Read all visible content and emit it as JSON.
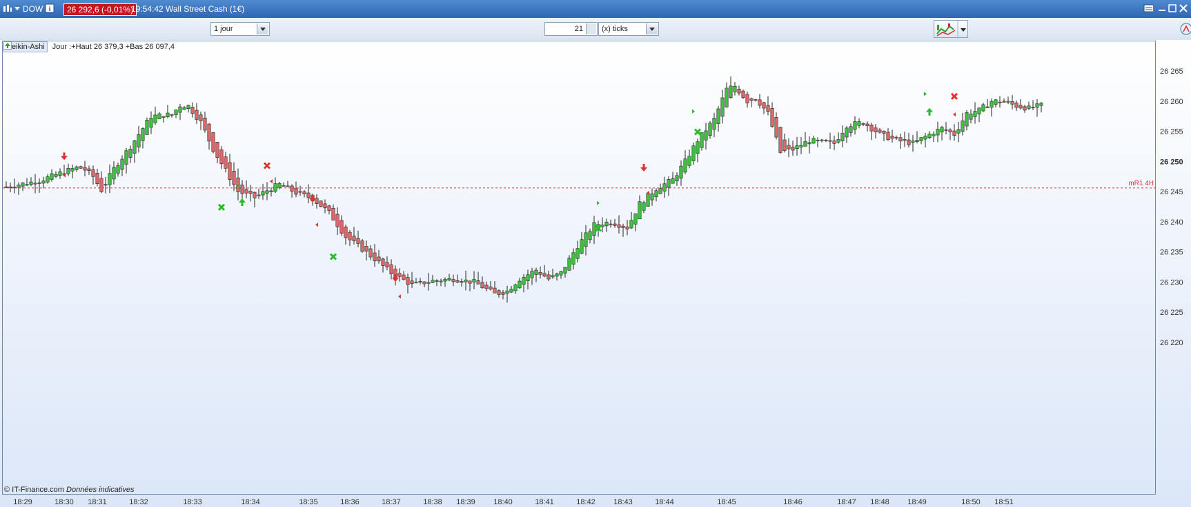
{
  "window": {
    "symbol": "DOW",
    "price_badge": "26 292,6 (-0,01%)",
    "time": "19:54:42",
    "instrument": "Wall Street Cash (1€)"
  },
  "toolbar": {
    "period_select": "1 jour",
    "tick_value": "21",
    "tick_unit_select": "(x) ticks"
  },
  "legend": {
    "chart_type": "Heikin-Ashi",
    "info": "Jour :+Haut 26 379,3 +Bas 26 097,4"
  },
  "footer": {
    "copyright": "© IT-Finance.com",
    "note": "Données indicatives"
  },
  "colors": {
    "up": "#3fc43f",
    "down": "#e06a6a",
    "level": "#e03030",
    "axis": "#333333"
  },
  "chart_data": {
    "type": "candlestick",
    "style": "Heikin-Ashi",
    "ylim": [
      26216,
      26267
    ],
    "y_ticks": [
      26220,
      26225,
      26230,
      26235,
      26240,
      26245,
      26250,
      26255,
      26260,
      26265
    ],
    "y_tick_labels": [
      "26 220",
      "26 225",
      "26 230",
      "26 235",
      "26 240",
      "26 245",
      "26 250",
      "26 255",
      "26 260",
      "26 265"
    ],
    "x_tick_labels": [
      "18:29",
      "18:30",
      "18:31",
      "18:32",
      "18:33",
      "18:34",
      "18:35",
      "18:36",
      "18:37",
      "18:38",
      "18:39",
      "18:40",
      "18:41",
      "18:42",
      "18:43",
      "18:44",
      "18:45",
      "18:46",
      "18:47",
      "18:48",
      "18:49",
      "18:50",
      "18:51"
    ],
    "x_tick_index": [
      4,
      14,
      22,
      32,
      45,
      59,
      73,
      83,
      93,
      103,
      111,
      120,
      130,
      140,
      149,
      159,
      174,
      190,
      203,
      211,
      220,
      233,
      241
    ],
    "level_line": {
      "label": "mR1 4H",
      "value": 26245.6
    },
    "anchors": [
      [
        0,
        26245.8
      ],
      [
        8,
        26246.8
      ],
      [
        14,
        26248.3
      ],
      [
        18,
        26249.2
      ],
      [
        21,
        26247.5
      ],
      [
        23,
        26245.2
      ],
      [
        26,
        26248.8
      ],
      [
        30,
        26252.5
      ],
      [
        35,
        26257.5
      ],
      [
        40,
        26257.8
      ],
      [
        42,
        26259.3
      ],
      [
        44,
        26259.2
      ],
      [
        47,
        26256.5
      ],
      [
        50,
        26252.0
      ],
      [
        53,
        26248.5
      ],
      [
        56,
        26245.0
      ],
      [
        60,
        26244.0
      ],
      [
        63,
        26245.2
      ],
      [
        66,
        26246.2
      ],
      [
        70,
        26244.8
      ],
      [
        74,
        26243.8
      ],
      [
        78,
        26241.5
      ],
      [
        82,
        26237.5
      ],
      [
        85,
        26236.0
      ],
      [
        89,
        26233.8
      ],
      [
        93,
        26231.5
      ],
      [
        98,
        26229.5
      ],
      [
        103,
        26230.2
      ],
      [
        108,
        26230.5
      ],
      [
        113,
        26230.0
      ],
      [
        118,
        26228.0
      ],
      [
        121,
        26228.5
      ],
      [
        124,
        26230.5
      ],
      [
        128,
        26232.0
      ],
      [
        131,
        26230.5
      ],
      [
        134,
        26231.5
      ],
      [
        138,
        26236.0
      ],
      [
        142,
        26239.5
      ],
      [
        146,
        26240.0
      ],
      [
        150,
        26239.0
      ],
      [
        153,
        26243.0
      ],
      [
        157,
        26245.5
      ],
      [
        161,
        26247.0
      ],
      [
        164,
        26250.0
      ],
      [
        167,
        26253.5
      ],
      [
        171,
        26257.0
      ],
      [
        174,
        26262.0
      ],
      [
        176,
        26262.5
      ],
      [
        179,
        26260.0
      ],
      [
        181,
        26260.5
      ],
      [
        184,
        26258.0
      ],
      [
        187,
        26251.5
      ],
      [
        190,
        26252.0
      ],
      [
        194,
        26253.5
      ],
      [
        197,
        26253.2
      ],
      [
        200,
        26253.0
      ],
      [
        203,
        26256.0
      ],
      [
        207,
        26256.5
      ],
      [
        211,
        26254.5
      ],
      [
        215,
        26253.5
      ],
      [
        219,
        26253.0
      ],
      [
        223,
        26254.5
      ],
      [
        226,
        26255.5
      ],
      [
        229,
        26254.5
      ],
      [
        232,
        26258.0
      ],
      [
        235,
        26258.5
      ],
      [
        238,
        26260.0
      ],
      [
        241,
        26260.0
      ],
      [
        244,
        26259.2
      ],
      [
        247,
        26258.8
      ],
      [
        250,
        26259.3
      ]
    ],
    "candle_count": 251,
    "signals": [
      {
        "type": "sell-arrow",
        "i": 14,
        "y": 26250.8
      },
      {
        "type": "small-left",
        "i": 14,
        "y": 26247.7
      },
      {
        "type": "cross-red",
        "i": 63,
        "y": 26249.3
      },
      {
        "type": "buy-arrow",
        "i": 57,
        "y": 26243.3
      },
      {
        "type": "cross-green",
        "i": 52,
        "y": 26242.4
      },
      {
        "type": "small-right",
        "i": 56,
        "y": 26246.0
      },
      {
        "type": "small-left",
        "i": 64,
        "y": 26246.7
      },
      {
        "type": "sell-arrow",
        "i": 74,
        "y": 26243.8
      },
      {
        "type": "small-left",
        "i": 75,
        "y": 26239.5
      },
      {
        "type": "cross-green",
        "i": 79,
        "y": 26234.2
      },
      {
        "type": "sell-arrow",
        "i": 94,
        "y": 26230.6
      },
      {
        "type": "small-left",
        "i": 95,
        "y": 26227.6
      },
      {
        "type": "cross-green",
        "i": 143,
        "y": 26238.9
      },
      {
        "type": "small-right",
        "i": 143,
        "y": 26243.1
      },
      {
        "type": "sell-arrow",
        "i": 154,
        "y": 26248.9
      },
      {
        "type": "small-left",
        "i": 155,
        "y": 26244.8
      },
      {
        "type": "cross-green",
        "i": 167,
        "y": 26254.9
      },
      {
        "type": "small-right",
        "i": 166,
        "y": 26258.3
      },
      {
        "type": "small-right",
        "i": 222,
        "y": 26261.2
      },
      {
        "type": "buy-arrow",
        "i": 223,
        "y": 26258.3
      },
      {
        "type": "cross-red",
        "i": 229,
        "y": 26260.8
      },
      {
        "type": "small-left",
        "i": 229,
        "y": 26257.8
      }
    ]
  }
}
